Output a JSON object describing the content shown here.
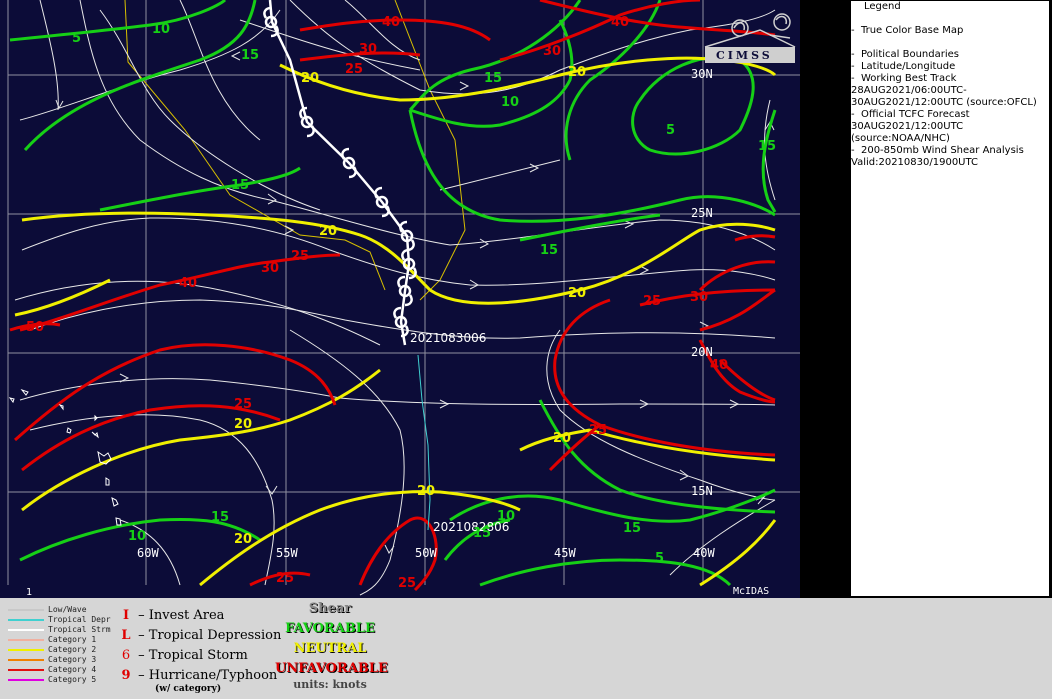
{
  "map": {
    "latitude_labels": [
      "30N",
      "25N",
      "20N",
      "15N"
    ],
    "longitude_labels": [
      "60W",
      "55W",
      "50W",
      "45W",
      "40W"
    ],
    "track_labels": [
      "2021083006",
      "2021082806"
    ],
    "frame_number": "1",
    "software_label": "McIDAS",
    "contour_labels_green": [
      "5",
      "10",
      "15",
      "15",
      "15",
      "15",
      "10",
      "5",
      "15",
      "15",
      "10",
      "15",
      "10",
      "15",
      "5"
    ],
    "contour_labels_yellow": [
      "20",
      "20",
      "20",
      "25",
      "20",
      "20",
      "20",
      "20",
      "20",
      "20"
    ],
    "contour_labels_red": [
      "40",
      "30",
      "25",
      "40",
      "30",
      "30",
      "25",
      "40",
      "25",
      "25",
      "30",
      "25",
      "25",
      "50"
    ],
    "colors": {
      "background": "#0c0c38",
      "favorable": "#16d016",
      "neutral": "#f0f000",
      "unfavorable": "#e00000",
      "streamline": "#ffffff",
      "grid": "#9090a0"
    },
    "logo_text": "CIMSS"
  },
  "legend": {
    "title": "Legend",
    "items": [
      "True Color Base Map",
      "Political Boundaries",
      "Latitude/Longitude",
      "Working Best Track",
      "28AUG2021/06:00UTC-",
      "30AUG2021/12:00UTC   (source:OFCL)",
      "Official TCFC Forecast",
      "30AUG2021/12:00UTC",
      "(source:NOAA/NHC)",
      "200-850mb Wind Shear Analysis",
      "Valid:20210830/1900UTC"
    ]
  },
  "track_key": [
    {
      "label": "Low/Wave",
      "color": "#c8c8c8"
    },
    {
      "label": "Tropical Depr",
      "color": "#40d0d0"
    },
    {
      "label": "Tropical Strm",
      "color": "#ffffff"
    },
    {
      "label": "Category 1",
      "color": "#f0b0a0"
    },
    {
      "label": "Category 2",
      "color": "#f0f000"
    },
    {
      "label": "Category 3",
      "color": "#f08000"
    },
    {
      "label": "Category 4",
      "color": "#e01010"
    },
    {
      "label": "Category 5",
      "color": "#e000e0"
    }
  ],
  "symbol_key": [
    {
      "glyph": "I",
      "label": "– Invest Area"
    },
    {
      "glyph": "L",
      "label": "– Tropical Depression"
    },
    {
      "glyph": "6",
      "label": "– Tropical Storm"
    },
    {
      "glyph": "9",
      "label": "– Hurricane/Typhoon"
    }
  ],
  "symbol_note": "(w/ category)",
  "shear_key": {
    "title": "Shear",
    "favorable": "FAVORABLE",
    "neutral": "NEUTRAL",
    "unfavorable": "UNFAVORABLE",
    "units": "units: knots"
  }
}
